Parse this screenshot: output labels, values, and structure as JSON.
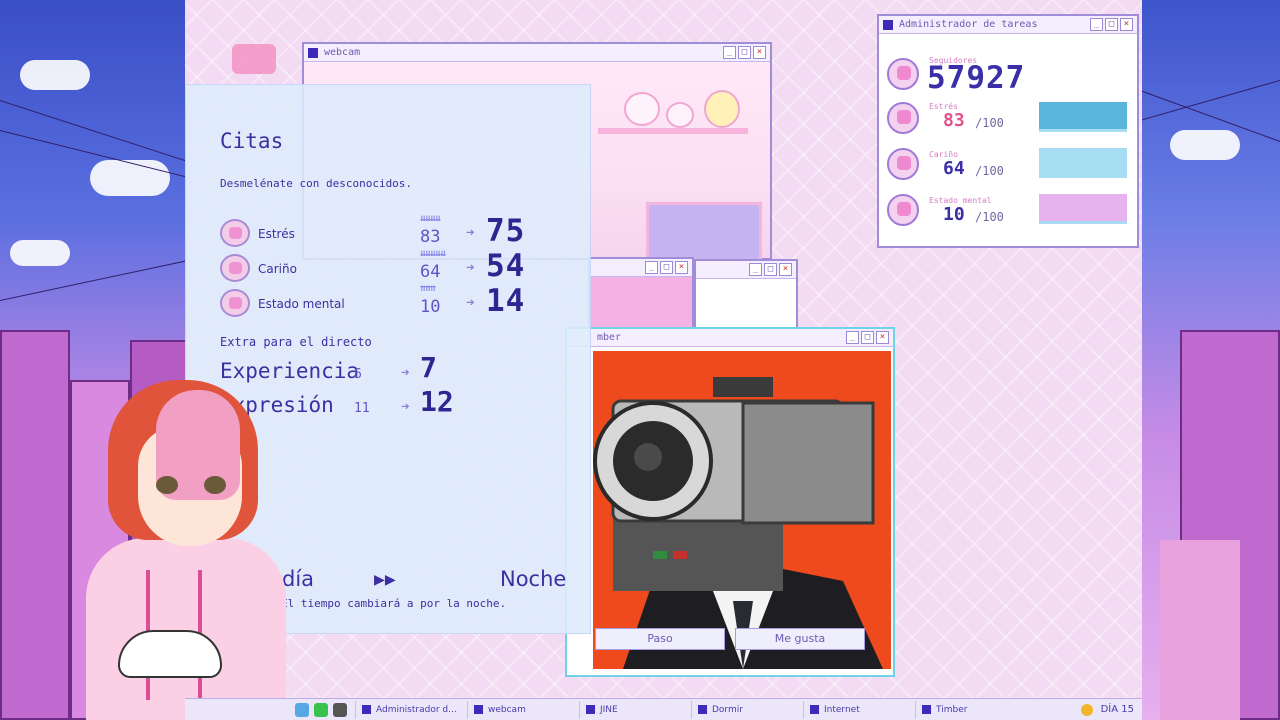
{
  "webcam": {
    "title": "webcam"
  },
  "task_manager": {
    "title": "Administrador de tareas",
    "followers_label": "Seguidores",
    "followers": "57927",
    "stats": [
      {
        "label": "Estrés",
        "value": "83",
        "max": "/100",
        "color": "#5bb6de",
        "level": 0.83
      },
      {
        "label": "Cariño",
        "value": "64",
        "max": "/100",
        "color": "#a7ddf2",
        "level": 0.64
      },
      {
        "label": "Estado mental",
        "value": "10",
        "max": "/100",
        "color": "#e6b3ef",
        "level": 0.1
      }
    ]
  },
  "timber": {
    "title": "mber",
    "pass_label": "Paso",
    "like_label": "Me gusta"
  },
  "citas": {
    "title": "Citas",
    "description": "Desmelénate con desconocidos.",
    "rows": [
      {
        "label": "Estrés",
        "old": "83",
        "new": "75",
        "ups": "⇊⇊⇊⇊"
      },
      {
        "label": "Cariño",
        "old": "64",
        "new": "54",
        "ups": "⇊⇊⇊⇊⇊"
      },
      {
        "label": "Estado mental",
        "old": "10",
        "new": "14",
        "ups": "⇈⇈⇈"
      }
    ],
    "extra_heading": "Extra para el directo",
    "experience_label": "Experiencia",
    "experience_old": "6",
    "experience_new": "7",
    "expression_label": "Expresión",
    "expression_old": "11",
    "expression_new": "12",
    "time_from": "diodía",
    "time_to": "Noche",
    "time_note": "El tiempo cambiará a por la noche."
  },
  "taskbar": {
    "items": [
      "Administrador d...",
      "webcam",
      "JINE",
      "Dormir",
      "Internet",
      "Timber"
    ],
    "day": "DÍA 15"
  }
}
